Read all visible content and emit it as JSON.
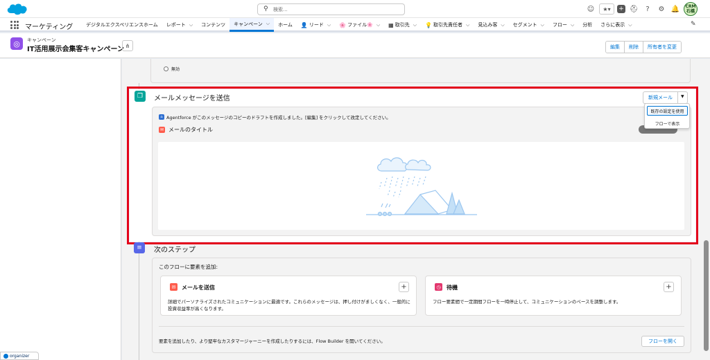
{
  "topbar": {
    "search_placeholder": "検索...",
    "avatar_text": "CRM\n石橋"
  },
  "nav": {
    "app_name": "マーケティング",
    "items": [
      {
        "label": "デジタルエクスペリエンスホーム",
        "chevron": false
      },
      {
        "label": "レポート",
        "chevron": true
      },
      {
        "label": "コンテンツ",
        "chevron": false
      },
      {
        "label": "キャンペーン",
        "chevron": true,
        "active": true
      },
      {
        "label": "ホーム",
        "chevron": false
      },
      {
        "label": "リード",
        "chevron": true,
        "glyph": "👤"
      },
      {
        "label": "ファイル",
        "chevron": true,
        "glyph": "🌸",
        "suffix": "🌸"
      },
      {
        "label": "取引先",
        "chevron": true,
        "glyph": "▦"
      },
      {
        "label": "取引先責任者",
        "chevron": true,
        "glyph": "💡"
      },
      {
        "label": "見込み客",
        "chevron": true
      },
      {
        "label": "セグメント",
        "chevron": true
      },
      {
        "label": "フロー",
        "chevron": true
      },
      {
        "label": "分析",
        "chevron": false
      },
      {
        "label": "さらに表示",
        "chevron": true
      }
    ]
  },
  "header": {
    "object_label": "キャンペーン",
    "title": "IT活用展示会集客キャンペーン",
    "buttons": [
      "編集",
      "削除",
      "所有者を変更"
    ]
  },
  "top_card": {
    "radio_label": "無効"
  },
  "email_step": {
    "title": "メールメッセージを送信",
    "new_mail_button": "新規メール",
    "dropdown_items": [
      "既存の設定を使用",
      "フローで表示"
    ],
    "agentforce_note": "Agentforce がこのメッセージのコピーのドラフトを作成しました。[編集] をクリックして改定してください。",
    "mail_title_label": "メールのタイトル"
  },
  "next_step": {
    "title": "次のステップ",
    "add_label": "このフローに要素を追加:",
    "options": [
      {
        "title": "メールを送信",
        "desc": "詳細でパーソナライズされたコミュニケーションに最適です。これらのメッセージは、押し付けがましくなく、一般的に投資収益率が高くなります。",
        "color": "#fe5c4c",
        "icon": "envelope-icon"
      },
      {
        "title": "待機",
        "desc": "フロー要素間で一定期間フローを一時停止して、コミュニケーションのペースを調整します。",
        "color": "#e3376e",
        "icon": "clock-icon"
      }
    ],
    "footer_text": "要素を追加したり、より堅牢なカスタマージャーニーを作成したりするには、Flow Builder を開いてください。",
    "open_flow_button": "フローを開く"
  },
  "organizer": {
    "label": "organizer"
  }
}
